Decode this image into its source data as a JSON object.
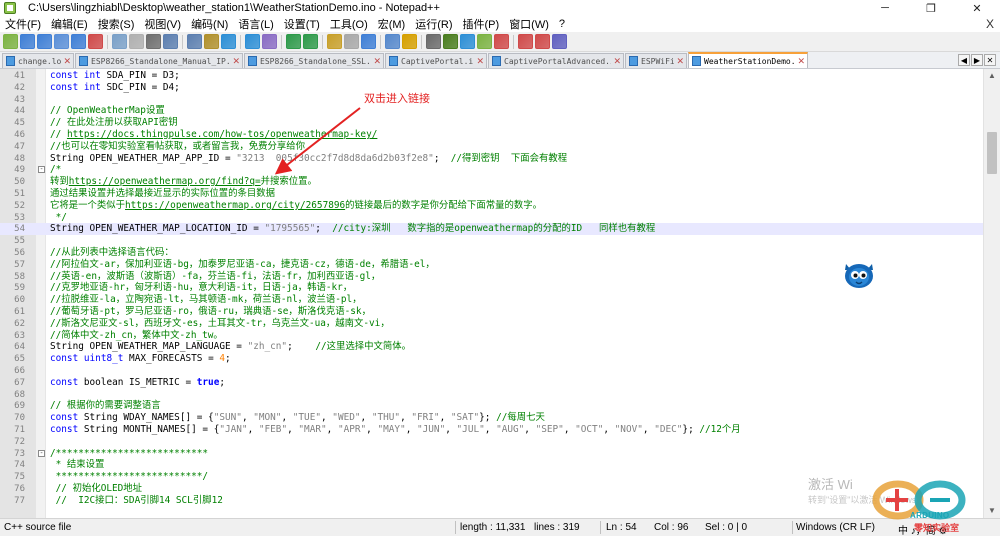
{
  "window": {
    "title": "C:\\Users\\lingzhiabl\\Desktop\\weather_station1\\WeatherStationDemo.ino - Notepad++",
    "minimize": "─",
    "maximize": "❐",
    "close": "✕"
  },
  "menu": [
    "文件(F)",
    "编辑(E)",
    "搜索(S)",
    "视图(V)",
    "编码(N)",
    "语言(L)",
    "设置(T)",
    "工具(O)",
    "宏(M)",
    "运行(R)",
    "插件(P)",
    "窗口(W)",
    "?"
  ],
  "menu_close": "X",
  "toolbar_colors": [
    "#7cb342",
    "#3f7fd6",
    "#3f7fd6",
    "#5a8fd8",
    "#3f7fd6",
    "#d04a4a",
    "#7aa0c8",
    "#b0b0b0",
    "#6f6f6f",
    "#5c7fb0",
    "#5c7fb0",
    "#b0902c",
    "#2d8fd6",
    "#2d8fd6",
    "#8a6cc4",
    "#2e9a4a",
    "#2e9a4a",
    "#c8a02a",
    "#a8a8a8",
    "#3f7fd6",
    "#5588cc",
    "#d6a000",
    "#6a6a6a",
    "#4a7d1f",
    "#2d8fd6",
    "#7cb342",
    "#d04a4a",
    "#d04a4a",
    "#d04a4a",
    "#6060c0"
  ],
  "tabs": [
    {
      "label": "change.log",
      "active": false
    },
    {
      "label": "ESP8266_Standalone_Manual_IP.ino",
      "active": false
    },
    {
      "label": "ESP8266_Standalone_SSL.ino",
      "active": false
    },
    {
      "label": "CaptivePortal.ino",
      "active": false
    },
    {
      "label": "CaptivePortalAdvanced.ino",
      "active": false
    },
    {
      "label": "ESPWiFi.h",
      "active": false
    },
    {
      "label": "WeatherStationDemo.ino",
      "active": true
    }
  ],
  "tab_close": "✕",
  "tab_scroll": [
    "◀",
    "▶",
    "✕"
  ],
  "editor": {
    "lines": [
      {
        "n": "41",
        "parts": [
          [
            "kw",
            "const int"
          ],
          [
            "t",
            " SDA_PIN = D3;"
          ]
        ]
      },
      {
        "n": "42",
        "parts": [
          [
            "kw",
            "const int"
          ],
          [
            "t",
            " SDC_PIN = D4;"
          ]
        ]
      },
      {
        "n": "43",
        "parts": []
      },
      {
        "n": "44",
        "parts": [
          [
            "cmt",
            "// OpenWeatherMap设置"
          ]
        ]
      },
      {
        "n": "45",
        "parts": [
          [
            "cmt",
            "// 在此处注册以获取API密钥"
          ]
        ]
      },
      {
        "n": "46",
        "parts": [
          [
            "cmt",
            "// "
          ],
          [
            "url",
            "https://docs.thingpulse.com/how-tos/openweathermap-key/"
          ]
        ]
      },
      {
        "n": "47",
        "parts": [
          [
            "cmt",
            "//也可以在零知实验室看帖获取，或者留言我，免费分享给你"
          ]
        ]
      },
      {
        "n": "48",
        "parts": [
          [
            "t",
            "String OPEN_WEATHER_MAP_APP_ID = "
          ],
          [
            "str",
            "\"3213  005f30cc2f7d8d8da6d2b03f2e8\""
          ],
          [
            "t",
            ";  "
          ],
          [
            "cmt",
            "//得到密钥  下面会有教程"
          ]
        ]
      },
      {
        "n": "49",
        "fold": "-",
        "parts": [
          [
            "cmt",
            "/*"
          ]
        ]
      },
      {
        "n": "50",
        "parts": [
          [
            "cmt",
            "转到"
          ],
          [
            "url",
            "https://openweathermap.org/find?q="
          ],
          [
            "cmt",
            "并搜索位置。"
          ]
        ]
      },
      {
        "n": "51",
        "parts": [
          [
            "cmt",
            "通过结果设置并选择最接近显示的实际位置的条目数据"
          ]
        ]
      },
      {
        "n": "52",
        "parts": [
          [
            "cmt",
            "它将是一个类似于"
          ],
          [
            "url",
            "https://openweathermap.org/city/2657896"
          ],
          [
            "cmt",
            "的链接最后的数字是你分配给下面常量的数字。"
          ]
        ]
      },
      {
        "n": "53",
        "parts": [
          [
            "cmt",
            " */"
          ]
        ]
      },
      {
        "n": "54",
        "hl": true,
        "parts": [
          [
            "t",
            "String OPEN_WEATHER_MAP_LOCATION_ID = "
          ],
          [
            "str",
            "\"1795565\""
          ],
          [
            "t",
            ";  "
          ],
          [
            "cmt",
            "//city:深圳   数字指的是openweathermap的分配的ID   同样也有教程"
          ]
        ]
      },
      {
        "n": "55",
        "parts": []
      },
      {
        "n": "56",
        "parts": [
          [
            "cmt",
            "//从此列表中选择语言代码："
          ]
        ]
      },
      {
        "n": "57",
        "parts": [
          [
            "cmt",
            "//阿拉伯文-ar，保加利亚语-bg，加泰罗尼亚语-ca，捷克语-cz，德语-de，希腊语-el，"
          ]
        ]
      },
      {
        "n": "58",
        "parts": [
          [
            "cmt",
            "//英语-en，波斯语（波斯语）-fa，芬兰语-fi，法语-fr，加利西亚语-gl，"
          ]
        ]
      },
      {
        "n": "59",
        "parts": [
          [
            "cmt",
            "//克罗地亚语-hr，匈牙利语-hu，意大利语-it，日语-ja，韩语-kr，"
          ]
        ]
      },
      {
        "n": "60",
        "parts": [
          [
            "cmt",
            "//拉脱维亚-la，立陶宛语-lt，马其顿语-mk，荷兰语-nl，波兰语-pl，"
          ]
        ]
      },
      {
        "n": "61",
        "parts": [
          [
            "cmt",
            "//葡萄牙语-pt，罗马尼亚语-ro，俄语-ru，瑞典语-se，斯洛伐克语-sk，"
          ]
        ]
      },
      {
        "n": "62",
        "parts": [
          [
            "cmt",
            "//斯洛文尼亚文-sl，西班牙文-es，土耳其文-tr，乌克兰文-ua，越南文-vi，"
          ]
        ]
      },
      {
        "n": "63",
        "parts": [
          [
            "cmt",
            "//简体中文-zh_cn，繁体中文-zh_tw。"
          ]
        ]
      },
      {
        "n": "64",
        "parts": [
          [
            "t",
            "String OPEN_WEATHER_MAP_LANGUAGE = "
          ],
          [
            "str",
            "\"zh_cn\""
          ],
          [
            "t",
            ";    "
          ],
          [
            "cmt",
            "//这里选择中文简体。"
          ]
        ]
      },
      {
        "n": "65",
        "parts": [
          [
            "kw",
            "const"
          ],
          [
            "t",
            " "
          ],
          [
            "kw",
            "uint8_t"
          ],
          [
            "t",
            " MAX_FORECASTS = "
          ],
          [
            "num",
            "4"
          ],
          [
            "t",
            ";"
          ]
        ]
      },
      {
        "n": "66",
        "parts": []
      },
      {
        "n": "67",
        "parts": [
          [
            "kw",
            "const"
          ],
          [
            "t",
            " boolean IS_METRIC = "
          ],
          [
            "bool",
            "true"
          ],
          [
            "t",
            ";"
          ]
        ]
      },
      {
        "n": "68",
        "parts": []
      },
      {
        "n": "69",
        "parts": [
          [
            "cmt",
            "// 根据你的需要调整语言"
          ]
        ]
      },
      {
        "n": "70",
        "parts": [
          [
            "kw",
            "const"
          ],
          [
            "t",
            " String WDAY_NAMES[] = {"
          ],
          [
            "str",
            "\"SUN\""
          ],
          [
            "t",
            ", "
          ],
          [
            "str",
            "\"MON\""
          ],
          [
            "t",
            ", "
          ],
          [
            "str",
            "\"TUE\""
          ],
          [
            "t",
            ", "
          ],
          [
            "str",
            "\"WED\""
          ],
          [
            "t",
            ", "
          ],
          [
            "str",
            "\"THU\""
          ],
          [
            "t",
            ", "
          ],
          [
            "str",
            "\"FRI\""
          ],
          [
            "t",
            ", "
          ],
          [
            "str",
            "\"SAT\""
          ],
          [
            "t",
            "}; "
          ],
          [
            "cmt",
            "//每周七天"
          ]
        ]
      },
      {
        "n": "71",
        "parts": [
          [
            "kw",
            "const"
          ],
          [
            "t",
            " String MONTH_NAMES[] = {"
          ],
          [
            "str",
            "\"JAN\""
          ],
          [
            "t",
            ", "
          ],
          [
            "str",
            "\"FEB\""
          ],
          [
            "t",
            ", "
          ],
          [
            "str",
            "\"MAR\""
          ],
          [
            "t",
            ", "
          ],
          [
            "str",
            "\"APR\""
          ],
          [
            "t",
            ", "
          ],
          [
            "str",
            "\"MAY\""
          ],
          [
            "t",
            ", "
          ],
          [
            "str",
            "\"JUN\""
          ],
          [
            "t",
            ", "
          ],
          [
            "str",
            "\"JUL\""
          ],
          [
            "t",
            ", "
          ],
          [
            "str",
            "\"AUG\""
          ],
          [
            "t",
            ", "
          ],
          [
            "str",
            "\"SEP\""
          ],
          [
            "t",
            ", "
          ],
          [
            "str",
            "\"OCT\""
          ],
          [
            "t",
            ", "
          ],
          [
            "str",
            "\"NOV\""
          ],
          [
            "t",
            ", "
          ],
          [
            "str",
            "\"DEC\""
          ],
          [
            "t",
            "}; "
          ],
          [
            "cmt",
            "//12个月"
          ]
        ]
      },
      {
        "n": "72",
        "parts": []
      },
      {
        "n": "73",
        "fold": "-",
        "parts": [
          [
            "cmt",
            "/***************************"
          ]
        ]
      },
      {
        "n": "74",
        "parts": [
          [
            "cmt",
            " * 结束设置"
          ]
        ]
      },
      {
        "n": "75",
        "parts": [
          [
            "cmt",
            " **************************/"
          ]
        ]
      },
      {
        "n": "76",
        "parts": [
          [
            "cmt",
            " // 初始化OLED地址"
          ]
        ]
      },
      {
        "n": "77",
        "parts": [
          [
            "cmt",
            " //  I2C接口：SDA引脚14 SCL引脚12"
          ]
        ]
      }
    ]
  },
  "annotation": "双击进入链接",
  "statusbar": {
    "type": "C++ source file",
    "length": "length : 11,331",
    "lines": "lines : 319",
    "ln": "Ln : 54",
    "col": "Col : 96",
    "sel": "Sel : 0 | 0",
    "eol": "Windows (CR LF)",
    "enc_tail": "中 ♪，简 ⚙"
  },
  "watermark": {
    "line1": "激活 Wi",
    "line2": "转到\"设置\"以激活 Windows"
  },
  "logo": {
    "text": "ARDUINO",
    "sub": "零知实验室"
  }
}
